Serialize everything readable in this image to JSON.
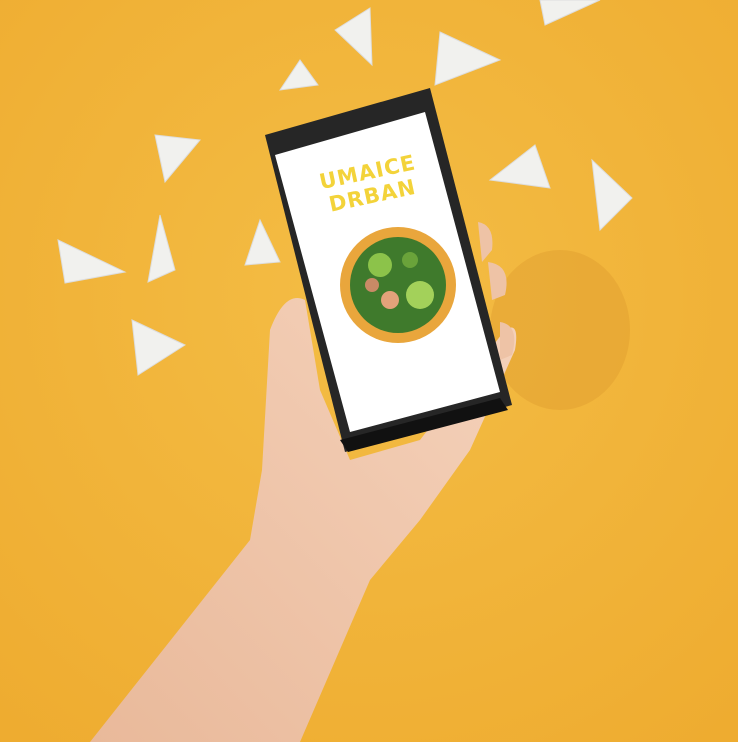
{
  "screen": {
    "title_line1": "UMAICE",
    "title_line2": "DRBAN"
  },
  "colors": {
    "background": "#f2b53a",
    "skin": "#f0c9ae",
    "phone": "#2a2a2a",
    "screen": "#ffffff",
    "text": "#f3d33a"
  }
}
